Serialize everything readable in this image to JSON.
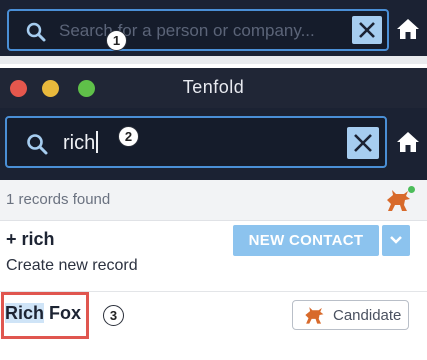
{
  "step1": {
    "search_placeholder": "Search for a person or company...",
    "marker": "1"
  },
  "window": {
    "title": "Tenfold",
    "search_value": "rich",
    "marker": "2"
  },
  "results": {
    "count_text": "1 records found",
    "new_record": {
      "title": "+ rich",
      "subtitle": "Create new record",
      "button_label": "NEW CONTACT"
    },
    "contact": {
      "name_highlight": "Rich",
      "name_rest": " Fox",
      "type_label": "Candidate",
      "marker": "3"
    }
  },
  "colors": {
    "dark_bar": "#1b2233",
    "accent_blue": "#4a8fd6",
    "button_blue": "#8cc3ee",
    "highlight_red": "#e0564f",
    "fox_orange": "#d86a2b"
  },
  "icons": [
    "search-icon",
    "close-icon",
    "home-icon",
    "fox-icon",
    "chevron-down-icon"
  ]
}
